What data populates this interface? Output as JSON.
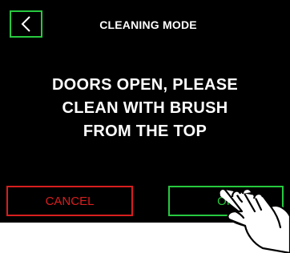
{
  "header": {
    "back_icon": "chevron-left-icon",
    "title": "CLEANING MODE"
  },
  "message": {
    "lines": [
      "DOORS OPEN, PLEASE",
      "CLEAN WITH BRUSH",
      "FROM THE TOP"
    ]
  },
  "actions": {
    "cancel_label": "CANCEL",
    "ok_label": "OK"
  },
  "pointer": {
    "icon": "pointing-hand-icon"
  },
  "colors": {
    "background": "#000000",
    "accent_green": "#27c93f",
    "cancel_red": "#d81e1e",
    "text": "#ffffff"
  }
}
